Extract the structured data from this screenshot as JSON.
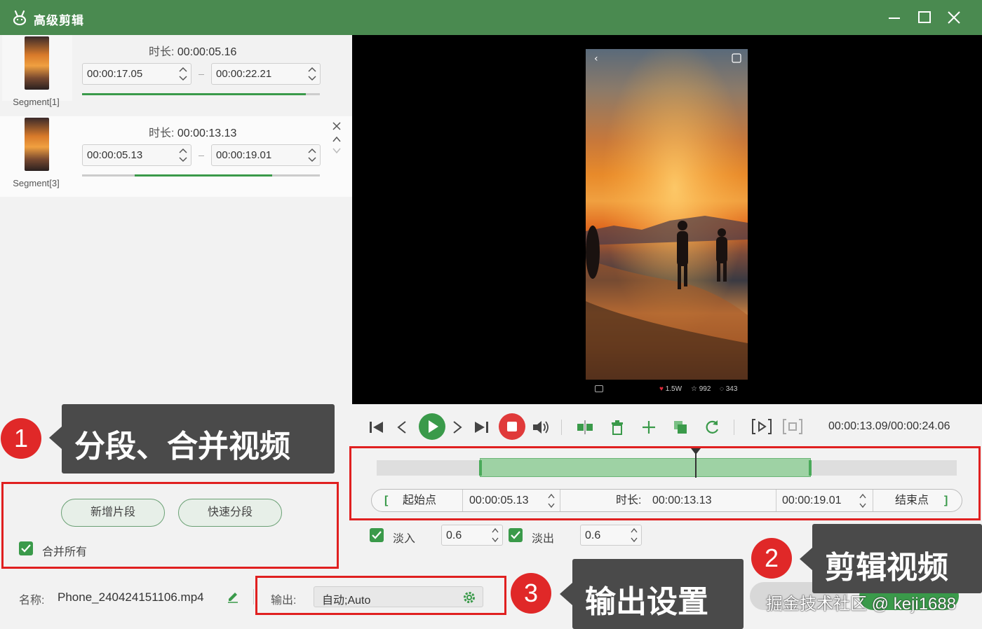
{
  "app": {
    "title": "高级剪辑"
  },
  "segments": [
    {
      "label": "Segment[1]",
      "duration_label": "时长:",
      "duration": "00:00:05.16",
      "start": "00:00:17.05",
      "end": "00:00:22.21",
      "progress_start": 0.0,
      "progress_end": 0.94
    },
    {
      "label": "Segment[3]",
      "duration_label": "时长:",
      "duration": "00:00:13.13",
      "start": "00:00:05.13",
      "end": "00:00:19.01",
      "progress_start": 0.22,
      "progress_end": 0.8
    }
  ],
  "left_actions": {
    "add_segment": "新增片段",
    "quick_split": "快速分段",
    "merge_all": "合并所有"
  },
  "file": {
    "name_label": "名称:",
    "name": "Phone_240424151106.mp4"
  },
  "output": {
    "label": "输出:",
    "value": "自动;Auto"
  },
  "player": {
    "timecode": "00:00:13.09/00:00:24.06"
  },
  "trim": {
    "start_label": "起始点",
    "start": "00:00:05.13",
    "duration_label": "时长:",
    "duration": "00:00:13.13",
    "end": "00:00:19.01",
    "end_label": "结束点",
    "range_start_fraction": 0.22,
    "range_end_fraction": 0.79,
    "playhead_fraction": 0.55
  },
  "fade": {
    "in_label": "淡入",
    "in_value": "0.6",
    "out_label": "淡出",
    "out_value": "0.6"
  },
  "social": {
    "likes": "1.5W",
    "favorites": "992",
    "comments": "343"
  },
  "annotations": [
    {
      "number": "1",
      "text": "分段、合并视频"
    },
    {
      "number": "2",
      "text": "剪辑视频"
    },
    {
      "number": "3",
      "text": "输出设置"
    }
  ],
  "watermark": "掘金技术社区 @ keji1688",
  "colors": {
    "titlebar": "#4a8a50",
    "accent": "#3a9a4a",
    "stop": "#e03a3a",
    "annotation_red": "#e02020"
  }
}
